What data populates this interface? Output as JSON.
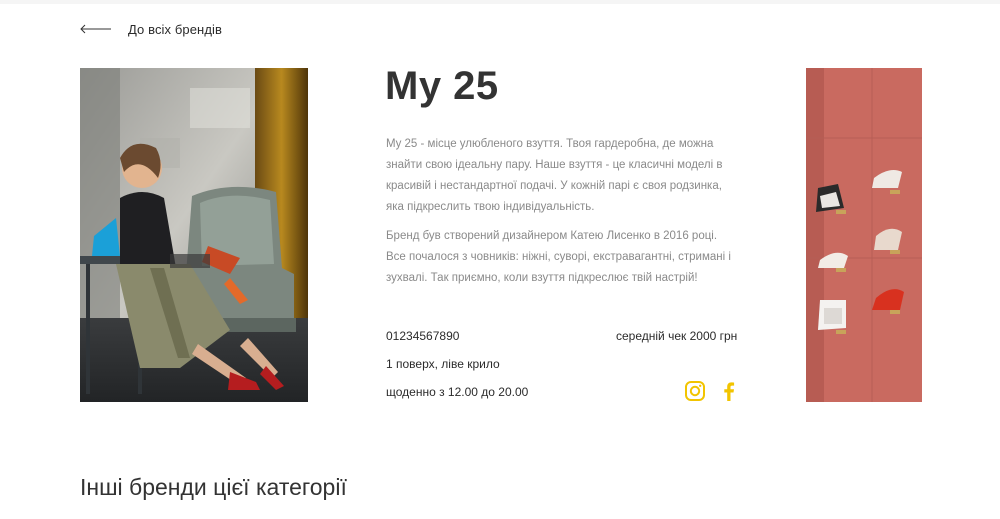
{
  "nav": {
    "back_label": "До всіх брендів"
  },
  "brand": {
    "title": "My 25",
    "description": [
      "My 25 - місце улюбленого взуття. Твоя гардеробна, де можна знайти свою ідеальну пару. Наше взуття - це класичні моделі в красивій і нестандартної подачі. У кожній парі є своя родзинка, яка підкреслить твою індивідуальність.",
      "Бренд був створений дизайнером Катею Лисенко в 2016 році. Все почалося з човників: ніжні, суворі, екстравагантні, стримані і зухвалі. Так приємно, коли взуття підкреслює твій настрій!"
    ],
    "phone": "01234567890",
    "avg_check": "середній чек 2000 грн",
    "location": "1 поверх, ліве крило",
    "hours": "щоденно з 12.00 до 20.00",
    "social": [
      {
        "name": "instagram-icon",
        "color": "#f2c400"
      },
      {
        "name": "facebook-icon",
        "color": "#f2c400"
      }
    ]
  },
  "images": {
    "left": "photo-woman-with-shoes",
    "right": "photo-shoe-display-wall"
  },
  "section": {
    "other_brands_title": "Інші бренди цієї категорії"
  },
  "colors": {
    "accent": "#f2c400",
    "text": "#333333",
    "muted": "#8a8a8a",
    "wall": "#c96a60"
  }
}
